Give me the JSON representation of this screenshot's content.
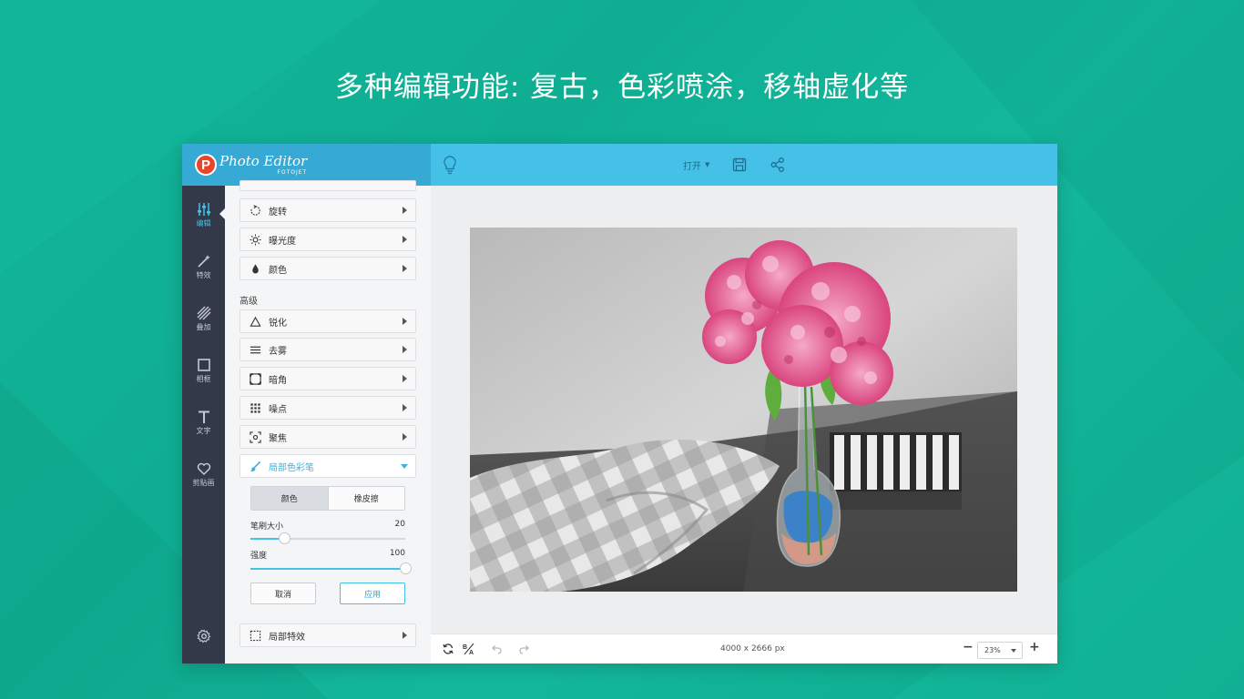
{
  "headline": "多种编辑功能: 复古，色彩喷涂，移轴虚化等",
  "colors": {
    "background": "#12b497",
    "topbar": "#45c1e8",
    "brand_bar": "#36a9d5",
    "left_nav": "#34394a",
    "accent": "#45c1e8",
    "logo_red": "#e9452b"
  },
  "brand": {
    "logo_letter": "P",
    "name": "Photo Editor",
    "sub": "FOTOJET"
  },
  "topbar": {
    "open_label": "打开",
    "icons": [
      "lightbulb-icon",
      "save-icon",
      "share-icon"
    ]
  },
  "left_nav": [
    {
      "label": "编辑",
      "icon": "sliders-icon",
      "active": true
    },
    {
      "label": "特效",
      "icon": "magic-wand-icon",
      "active": false
    },
    {
      "label": "叠加",
      "icon": "overlay-stripes-icon",
      "active": false
    },
    {
      "label": "相框",
      "icon": "frame-icon",
      "active": false
    },
    {
      "label": "文字",
      "icon": "text-icon",
      "active": false
    },
    {
      "label": "剪贴画",
      "icon": "heart-icon",
      "active": false
    }
  ],
  "panel": {
    "basic_items": [
      {
        "label": "旋转",
        "icon": "rotate-icon"
      },
      {
        "label": "曝光度",
        "icon": "sun-icon"
      },
      {
        "label": "颜色",
        "icon": "drop-icon"
      }
    ],
    "advanced_title": "高级",
    "advanced_items": [
      {
        "label": "锐化",
        "icon": "triangle-icon"
      },
      {
        "label": "去雾",
        "icon": "lines-icon"
      },
      {
        "label": "暗角",
        "icon": "vignette-icon"
      },
      {
        "label": "噪点",
        "icon": "grid-dots-icon"
      },
      {
        "label": "聚焦",
        "icon": "focus-icon"
      }
    ],
    "brush": {
      "label": "局部色彩笔",
      "icon": "brush-icon",
      "tabs": [
        "颜色",
        "橡皮擦"
      ],
      "selected_tab": "颜色",
      "brush_size_label": "笔刷大小",
      "brush_size": "20",
      "brush_size_fraction": 0.22,
      "strength_label": "强度",
      "strength": "100",
      "strength_fraction": 1.0,
      "cancel": "取消",
      "apply": "应用"
    },
    "local_effects": {
      "label": "局部特效",
      "icon": "dashed-square-icon"
    }
  },
  "bottombar": {
    "dimensions": "4000 x 2666 px",
    "zoom": "23%",
    "icons": [
      "reset-icon",
      "compare-icon",
      "undo-icon",
      "redo-icon"
    ]
  }
}
